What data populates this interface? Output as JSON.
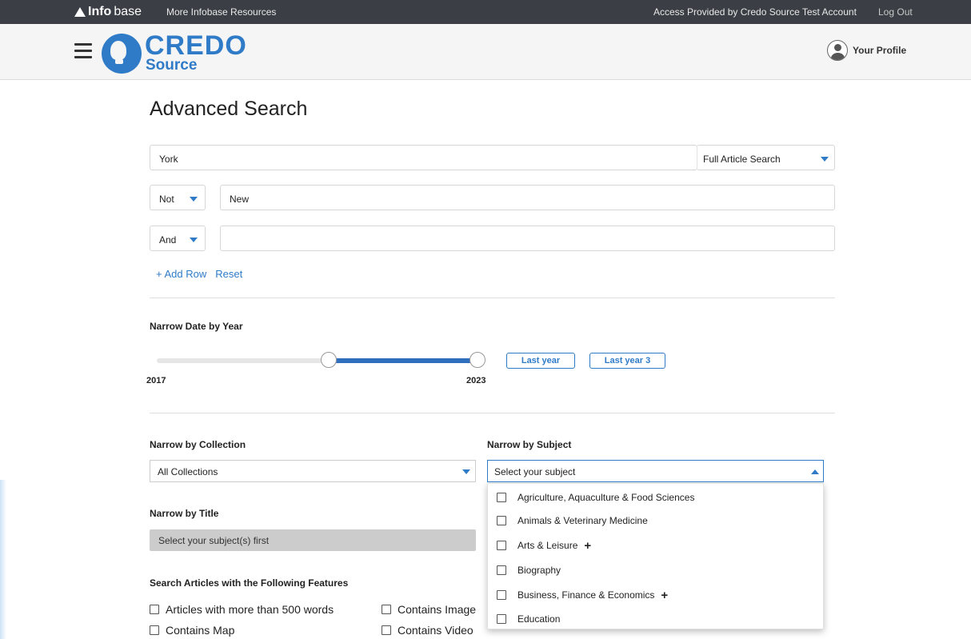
{
  "topbar": {
    "brand_info": "Info",
    "brand_base": "base",
    "resources": "More Infobase Resources",
    "access": "Access Provided by Credo Source Test Account",
    "logout": "Log Out"
  },
  "header": {
    "logo_main": "CREDO",
    "logo_sub": "Source",
    "profile": "Your Profile"
  },
  "page": {
    "title": "Advanced Search"
  },
  "search": {
    "row1_value": "York",
    "search_type": "Full Article Search",
    "row2_operator": "Not",
    "row2_value": "New",
    "row3_operator": "And",
    "row3_value": "",
    "add_row": "+ Add Row",
    "reset": "Reset"
  },
  "date": {
    "label": "Narrow Date by Year",
    "start": "2017",
    "end": "2023",
    "last_year": "Last year",
    "last_year_3": "Last year 3"
  },
  "collection": {
    "label": "Narrow by Collection",
    "selected": "All Collections"
  },
  "subject": {
    "label": "Narrow by Subject",
    "placeholder": "Select your subject",
    "options": [
      {
        "label": "Agriculture, Aquaculture & Food Sciences",
        "expandable": ""
      },
      {
        "label": "Animals & Veterinary Medicine",
        "expandable": ""
      },
      {
        "label": "Arts & Leisure",
        "expandable": "+"
      },
      {
        "label": "Biography",
        "expandable": ""
      },
      {
        "label": "Business, Finance & Economics",
        "expandable": "+"
      },
      {
        "label": "Education",
        "expandable": ""
      }
    ]
  },
  "title_filter": {
    "label": "Narrow by Title",
    "placeholder": "Select your subject(s) first"
  },
  "features": {
    "label": "Search Articles with the Following Features",
    "items": [
      "Articles with more than 500 words",
      "Contains Image",
      "Contains Map",
      "Contains Video"
    ]
  },
  "colors": {
    "accent": "#2f7bc8",
    "topbar": "#3b3e44"
  }
}
